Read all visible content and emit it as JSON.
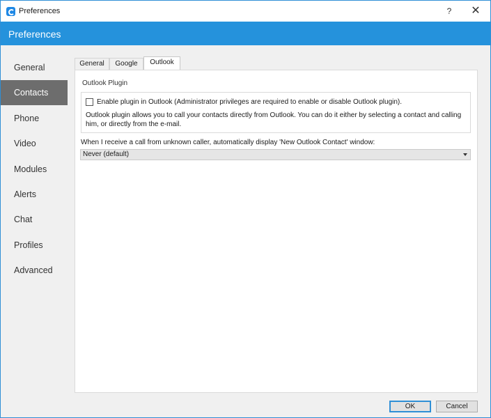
{
  "window": {
    "title": "Preferences",
    "help_label": "?",
    "close_label": "✕"
  },
  "header": {
    "title": "Preferences"
  },
  "sidebar": {
    "items": [
      {
        "label": "General"
      },
      {
        "label": "Contacts",
        "active": true
      },
      {
        "label": "Phone"
      },
      {
        "label": "Video"
      },
      {
        "label": "Modules"
      },
      {
        "label": "Alerts"
      },
      {
        "label": "Chat"
      },
      {
        "label": "Profiles"
      },
      {
        "label": "Advanced"
      }
    ]
  },
  "tabs": [
    {
      "label": "General"
    },
    {
      "label": "Google"
    },
    {
      "label": "Outlook",
      "active": true
    }
  ],
  "outlook": {
    "section_title": "Outlook Plugin",
    "enable_plugin_label": "Enable plugin in Outlook (Administrator privileges are required to enable or disable Outlook plugin).",
    "enable_plugin_checked": false,
    "description": "Outlook plugin allows you to call your contacts directly from Outlook. You can do it either by selecting a contact and calling him, or directly from the e-mail.",
    "unknown_caller_label": "When I receive a call from unknown caller, automatically display 'New Outlook Contact' window:",
    "unknown_caller_value": "Never (default)"
  },
  "buttons": {
    "ok_label": "OK",
    "cancel_label": "Cancel"
  },
  "colors": {
    "accent": "#2592dc",
    "sidebar_active": "#6d6d6d",
    "background": "#f0f0f0"
  }
}
